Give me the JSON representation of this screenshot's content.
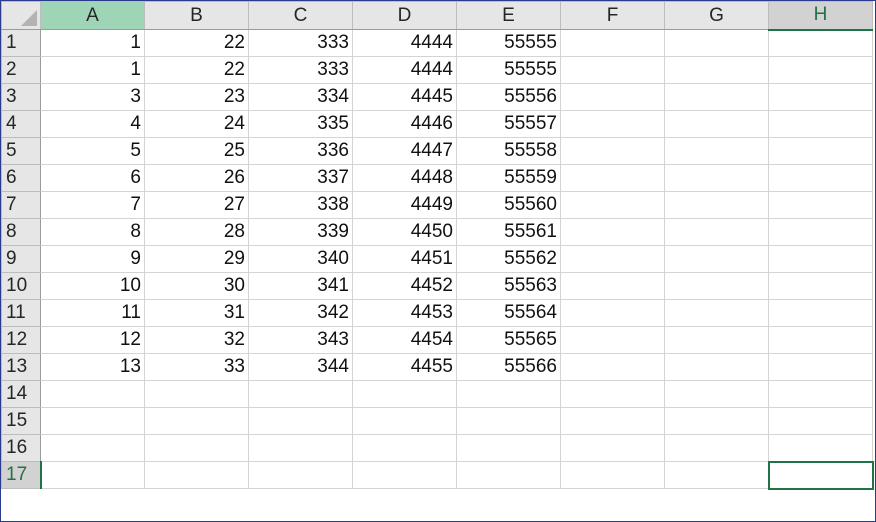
{
  "sheet": {
    "columns": [
      "A",
      "B",
      "C",
      "D",
      "E",
      "F",
      "G",
      "H"
    ],
    "selected_column": "H",
    "selected_row": 17,
    "active_cell": "H17",
    "rows": [
      {
        "n": "1",
        "cells": [
          "1",
          "22",
          "333",
          "4444",
          "55555",
          "",
          "",
          ""
        ]
      },
      {
        "n": "2",
        "cells": [
          "1",
          "22",
          "333",
          "4444",
          "55555",
          "",
          "",
          ""
        ]
      },
      {
        "n": "3",
        "cells": [
          "3",
          "23",
          "334",
          "4445",
          "55556",
          "",
          "",
          ""
        ]
      },
      {
        "n": "4",
        "cells": [
          "4",
          "24",
          "335",
          "4446",
          "55557",
          "",
          "",
          ""
        ]
      },
      {
        "n": "5",
        "cells": [
          "5",
          "25",
          "336",
          "4447",
          "55558",
          "",
          "",
          ""
        ]
      },
      {
        "n": "6",
        "cells": [
          "6",
          "26",
          "337",
          "4448",
          "55559",
          "",
          "",
          ""
        ]
      },
      {
        "n": "7",
        "cells": [
          "7",
          "27",
          "338",
          "4449",
          "55560",
          "",
          "",
          ""
        ]
      },
      {
        "n": "8",
        "cells": [
          "8",
          "28",
          "339",
          "4450",
          "55561",
          "",
          "",
          ""
        ]
      },
      {
        "n": "9",
        "cells": [
          "9",
          "29",
          "340",
          "4451",
          "55562",
          "",
          "",
          ""
        ]
      },
      {
        "n": "10",
        "cells": [
          "10",
          "30",
          "341",
          "4452",
          "55563",
          "",
          "",
          ""
        ]
      },
      {
        "n": "11",
        "cells": [
          "11",
          "31",
          "342",
          "4453",
          "55564",
          "",
          "",
          ""
        ]
      },
      {
        "n": "12",
        "cells": [
          "12",
          "32",
          "343",
          "4454",
          "55565",
          "",
          "",
          ""
        ]
      },
      {
        "n": "13",
        "cells": [
          "13",
          "33",
          "344",
          "4455",
          "55566",
          "",
          "",
          ""
        ]
      },
      {
        "n": "14",
        "cells": [
          "",
          "",
          "",
          "",
          "",
          "",
          "",
          ""
        ]
      },
      {
        "n": "15",
        "cells": [
          "",
          "",
          "",
          "",
          "",
          "",
          "",
          ""
        ]
      },
      {
        "n": "16",
        "cells": [
          "",
          "",
          "",
          "",
          "",
          "",
          "",
          ""
        ]
      },
      {
        "n": "17",
        "cells": [
          "",
          "",
          "",
          "",
          "",
          "",
          "",
          ""
        ]
      }
    ]
  }
}
